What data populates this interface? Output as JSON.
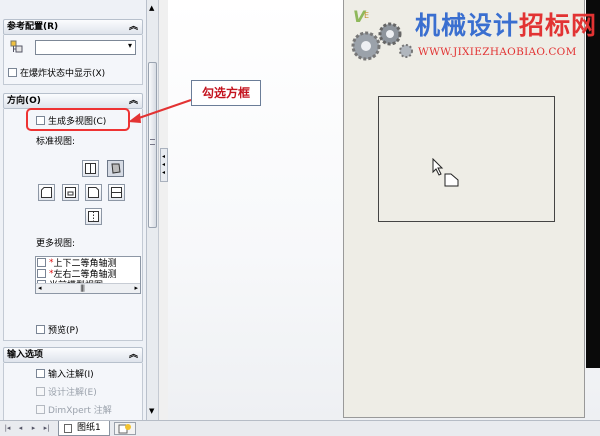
{
  "panel": {
    "ref_config": {
      "title": "参考配置(R)",
      "select_value": "",
      "explode_label": "在爆炸状态中显示(X)"
    },
    "orientation": {
      "title": "方向(O)",
      "create_multi_label": "生成多视图(C)",
      "standard_views_label": "标准视图:",
      "more_views_label": "更多视图:",
      "more_views": [
        {
          "prefix": "*",
          "text": "上下二等角轴测"
        },
        {
          "prefix": "*",
          "text": "左右二等角轴测"
        },
        {
          "prefix": "",
          "text": "当前模型视图"
        }
      ],
      "preview_label": "预览(P)"
    },
    "import_options": {
      "title": "输入选项",
      "items": [
        {
          "label": "输入注解(I)",
          "enabled": true
        },
        {
          "label": "设计注解(E)",
          "enabled": false
        },
        {
          "label": "DimXpert 注解",
          "enabled": false
        }
      ]
    }
  },
  "annotation": {
    "callout": "勾选方框"
  },
  "watermark": {
    "title_blue": "机械设计",
    "title_red": "招标网",
    "url": "WWW.JIXIEZHAOBIAO.COM"
  },
  "tabs": {
    "sheet_label": "图纸1"
  },
  "colors": {
    "highlight": "#e33333",
    "callout_text": "#c4141f",
    "watermark_blue": "#3a6fd0",
    "watermark_red": "#e23333"
  }
}
